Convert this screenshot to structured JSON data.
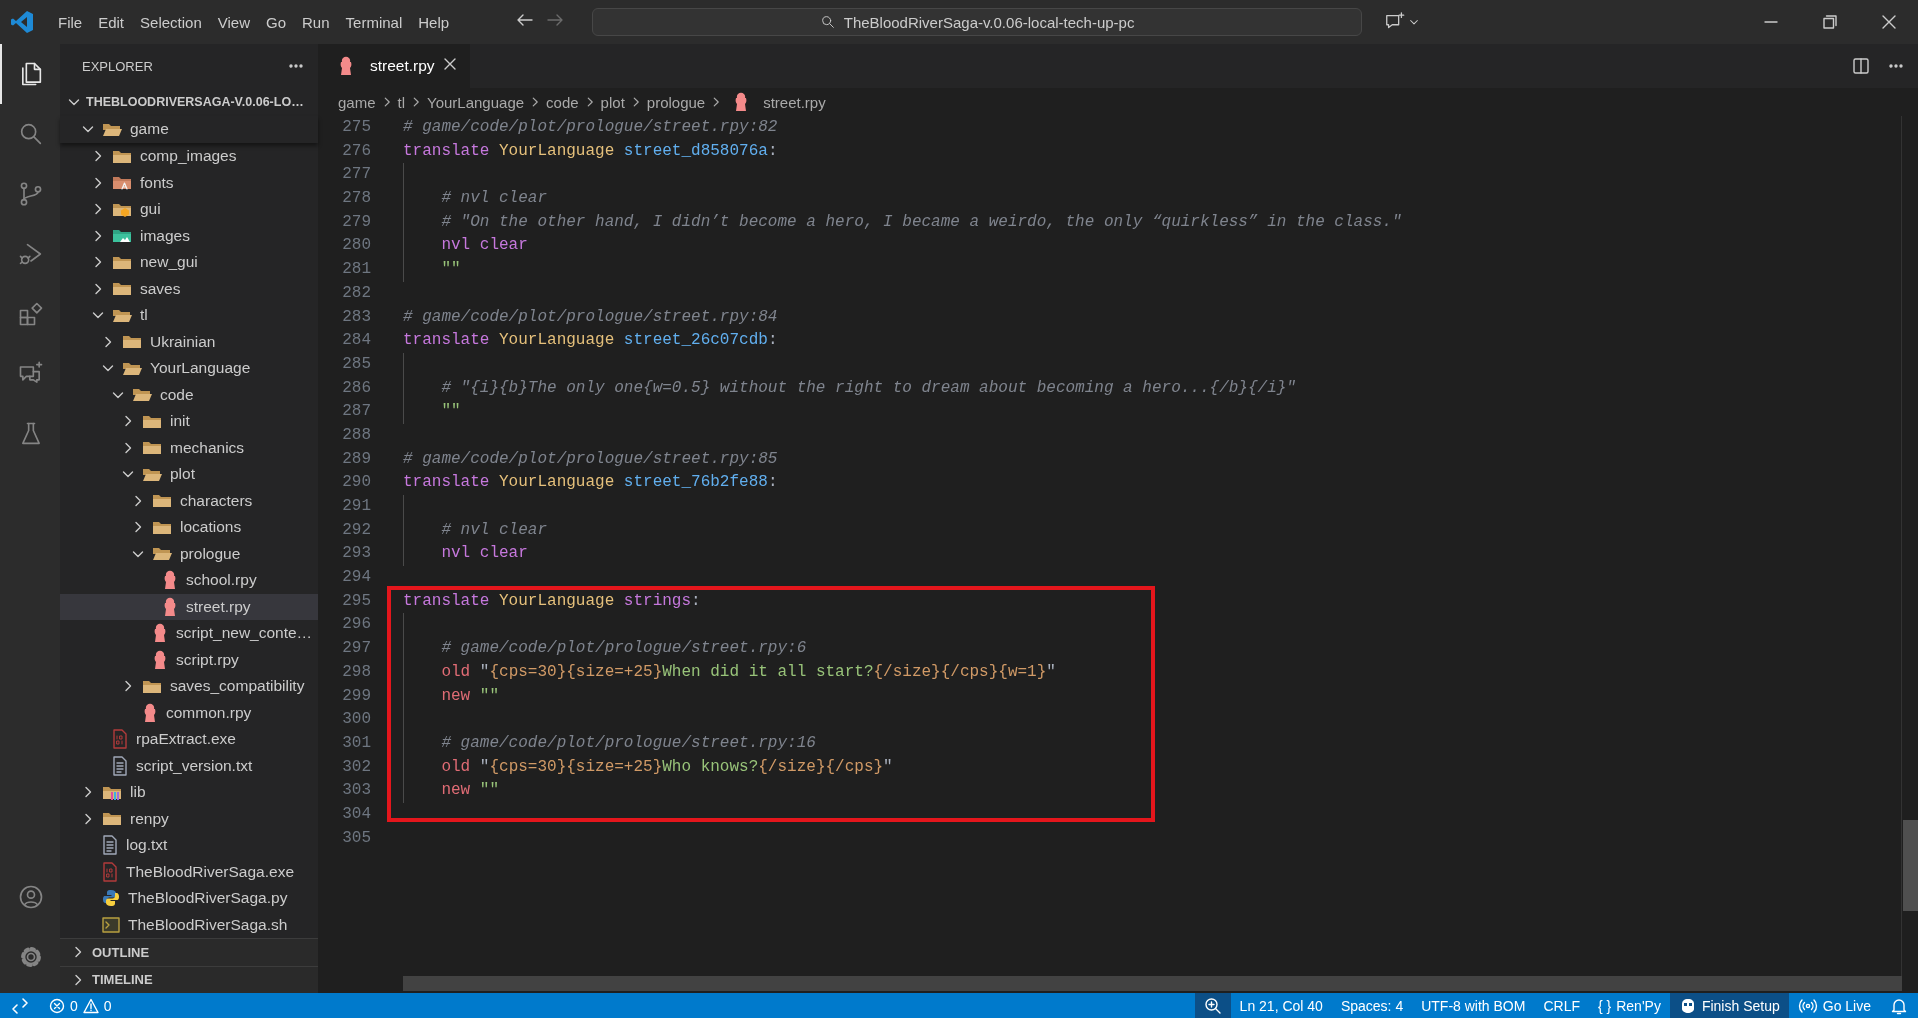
{
  "titlebar": {
    "menu": [
      "File",
      "Edit",
      "Selection",
      "View",
      "Go",
      "Run",
      "Terminal",
      "Help"
    ],
    "navigation": [
      {
        "kind": "back",
        "disabled": false
      },
      {
        "kind": "forward",
        "disabled": true
      }
    ],
    "search": "TheBloodRiverSaga-v.0.06-local-tech-up-pc"
  },
  "activity_bar": {
    "top": [
      {
        "kind": "explorer",
        "selected": true
      },
      {
        "kind": "search",
        "selected": false
      },
      {
        "kind": "source-control",
        "selected": false
      },
      {
        "kind": "run-debug",
        "selected": false
      },
      {
        "kind": "extensions",
        "selected": false
      },
      {
        "kind": "chat",
        "selected": false
      },
      {
        "kind": "testing",
        "selected": false
      }
    ],
    "bottom": [
      {
        "kind": "account"
      },
      {
        "kind": "manage"
      }
    ]
  },
  "sidebar": {
    "title": "EXPLORER",
    "root": {
      "label": "THEBLOODRIVERSAGA-V.0.06-LO…",
      "expanded": true
    },
    "tree": [
      {
        "label": "game",
        "kind": "folder",
        "expanded": true,
        "selected": false,
        "children": [
          {
            "label": "comp_images",
            "kind": "folder",
            "expanded": false,
            "selected": false
          },
          {
            "label": "fonts",
            "kind": "fonts-folder",
            "expanded": false,
            "selected": false
          },
          {
            "label": "gui",
            "kind": "gui-folder",
            "expanded": false,
            "selected": false
          },
          {
            "label": "images",
            "kind": "images-folder",
            "expanded": false,
            "selected": false
          },
          {
            "label": "new_gui",
            "kind": "folder",
            "expanded": false,
            "selected": false
          },
          {
            "label": "saves",
            "kind": "folder",
            "expanded": false,
            "selected": false
          },
          {
            "label": "tl",
            "kind": "folder",
            "expanded": true,
            "selected": false,
            "children": [
              {
                "label": "Ukrainian",
                "kind": "folder",
                "expanded": false,
                "selected": false
              },
              {
                "label": "YourLanguage",
                "kind": "folder",
                "expanded": true,
                "selected": false,
                "children": [
                  {
                    "label": "code",
                    "kind": "folder",
                    "expanded": true,
                    "selected": false,
                    "children": [
                      {
                        "label": "init",
                        "kind": "folder",
                        "expanded": false,
                        "selected": false
                      },
                      {
                        "label": "mechanics",
                        "kind": "folder",
                        "expanded": false,
                        "selected": false
                      },
                      {
                        "label": "plot",
                        "kind": "folder",
                        "expanded": true,
                        "selected": false,
                        "children": [
                          {
                            "label": "characters",
                            "kind": "folder",
                            "expanded": false,
                            "selected": false
                          },
                          {
                            "label": "locations",
                            "kind": "folder",
                            "expanded": false,
                            "selected": false
                          },
                          {
                            "label": "prologue",
                            "kind": "folder",
                            "expanded": true,
                            "selected": false,
                            "children": [
                              {
                                "label": "school.rpy",
                                "kind": "renpy",
                                "selected": false
                              },
                              {
                                "label": "street.rpy",
                                "kind": "renpy",
                                "selected": true
                              }
                            ]
                          },
                          {
                            "label": "script_new_conte…",
                            "kind": "renpy",
                            "selected": false
                          },
                          {
                            "label": "script.rpy",
                            "kind": "renpy",
                            "selected": false
                          }
                        ]
                      },
                      {
                        "label": "saves_compatibility",
                        "kind": "folder",
                        "expanded": false,
                        "selected": false
                      },
                      {
                        "label": "common.rpy",
                        "kind": "renpy",
                        "selected": false
                      }
                    ]
                  }
                ]
              }
            ]
          },
          {
            "label": "rpaExtract.exe",
            "kind": "binary",
            "selected": false
          },
          {
            "label": "script_version.txt",
            "kind": "text",
            "selected": false
          }
        ]
      },
      {
        "label": "lib",
        "kind": "lib-folder",
        "expanded": false,
        "selected": false
      },
      {
        "label": "renpy",
        "kind": "folder",
        "expanded": false,
        "selected": false
      },
      {
        "label": "log.txt",
        "kind": "text",
        "selected": false
      },
      {
        "label": "TheBloodRiverSaga.exe",
        "kind": "binary",
        "selected": false
      },
      {
        "label": "TheBloodRiverSaga.py",
        "kind": "python",
        "selected": false
      },
      {
        "label": "TheBloodRiverSaga.sh",
        "kind": "shell",
        "selected": false
      }
    ],
    "panels": [
      {
        "label": "OUTLINE",
        "expanded": false
      },
      {
        "label": "TIMELINE",
        "expanded": false
      }
    ]
  },
  "tabs": [
    {
      "label": "street.rpy",
      "selected": true
    }
  ],
  "breadcrumbs": [
    {
      "label": "game",
      "kind": "folder"
    },
    {
      "label": "tl",
      "kind": "folder"
    },
    {
      "label": "YourLanguage",
      "kind": "folder"
    },
    {
      "label": "code",
      "kind": "folder"
    },
    {
      "label": "plot",
      "kind": "folder"
    },
    {
      "label": "prologue",
      "kind": "folder"
    },
    {
      "label": "street.rpy",
      "kind": "renpy"
    }
  ],
  "editor": {
    "blocks": [
      {
        "framed": false,
        "lines": [
          {
            "number": "275",
            "indented": false,
            "tokens": [
              {
                "kind": "comment",
                "text": "# game/code/plot/prologue/street.rpy:82"
              }
            ]
          },
          {
            "number": "276",
            "indented": false,
            "tokens": [
              {
                "kind": "keyword",
                "text": "translate "
              },
              {
                "kind": "language",
                "text": "YourLanguage "
              },
              {
                "kind": "label",
                "text": "street_d858076a"
              },
              {
                "kind": "plain",
                "text": ":"
              }
            ]
          },
          {
            "number": "277",
            "indented": true
          },
          {
            "number": "278",
            "indented": true,
            "tokens": [
              {
                "kind": "comment",
                "text": "# nvl clear"
              }
            ]
          },
          {
            "number": "279",
            "indented": true,
            "tokens": [
              {
                "kind": "comment",
                "text": "# \"On the other hand, I didn’t become a hero, I became a weirdo, the only “quirkless” in the class.\""
              }
            ]
          },
          {
            "number": "280",
            "indented": true,
            "tokens": [
              {
                "kind": "keyword",
                "text": "nvl clear"
              }
            ]
          },
          {
            "number": "281",
            "indented": true,
            "tokens": [
              {
                "kind": "string",
                "text": "\"\""
              }
            ]
          },
          {
            "number": "282",
            "indented": false
          },
          {
            "number": "283",
            "indented": false,
            "tokens": [
              {
                "kind": "comment",
                "text": "# game/code/plot/prologue/street.rpy:84"
              }
            ]
          },
          {
            "number": "284",
            "indented": false,
            "tokens": [
              {
                "kind": "keyword",
                "text": "translate "
              },
              {
                "kind": "language",
                "text": "YourLanguage "
              },
              {
                "kind": "label",
                "text": "street_26c07cdb"
              },
              {
                "kind": "plain",
                "text": ":"
              }
            ]
          },
          {
            "number": "285",
            "indented": true
          },
          {
            "number": "286",
            "indented": true,
            "tokens": [
              {
                "kind": "comment",
                "text": "# \"{i}{b}The only one{w=0.5} without the right to dream about becoming a hero...{/b}{/i}\""
              }
            ]
          },
          {
            "number": "287",
            "indented": true,
            "tokens": [
              {
                "kind": "string",
                "text": "\"\""
              }
            ]
          },
          {
            "number": "288",
            "indented": false
          },
          {
            "number": "289",
            "indented": false,
            "tokens": [
              {
                "kind": "comment",
                "text": "# game/code/plot/prologue/street.rpy:85"
              }
            ]
          },
          {
            "number": "290",
            "indented": false,
            "tokens": [
              {
                "kind": "keyword",
                "text": "translate "
              },
              {
                "kind": "language",
                "text": "YourLanguage "
              },
              {
                "kind": "label",
                "text": "street_76b2fe88"
              },
              {
                "kind": "plain",
                "text": ":"
              }
            ]
          },
          {
            "number": "291",
            "indented": true
          },
          {
            "number": "292",
            "indented": true,
            "tokens": [
              {
                "kind": "comment",
                "text": "# nvl clear"
              }
            ]
          },
          {
            "number": "293",
            "indented": true,
            "tokens": [
              {
                "kind": "keyword",
                "text": "nvl clear"
              }
            ]
          },
          {
            "number": "294",
            "indented": false
          }
        ]
      },
      {
        "framed": true,
        "lines": [
          {
            "number": "295",
            "indented": false,
            "tokens": [
              {
                "kind": "keyword",
                "text": "translate "
              },
              {
                "kind": "language",
                "text": "YourLanguage "
              },
              {
                "kind": "keyword",
                "text": "strings"
              },
              {
                "kind": "plain",
                "text": ":"
              }
            ]
          },
          {
            "number": "296",
            "indented": true
          },
          {
            "number": "297",
            "indented": true,
            "tokens": [
              {
                "kind": "comment",
                "text": "# game/code/plot/prologue/street.rpy:6"
              }
            ]
          },
          {
            "number": "298",
            "indented": true,
            "tokens": [
              {
                "kind": "property",
                "text": "old "
              },
              {
                "kind": "plain",
                "text": "\""
              },
              {
                "kind": "tag",
                "text": "{cps=30}{size=+25}"
              },
              {
                "kind": "string",
                "text": "When did it all start?"
              },
              {
                "kind": "tag",
                "text": "{/size}{/cps}{w=1}"
              },
              {
                "kind": "plain",
                "text": "\""
              }
            ]
          },
          {
            "number": "299",
            "indented": true,
            "tokens": [
              {
                "kind": "property",
                "text": "new "
              },
              {
                "kind": "string",
                "text": "\"\""
              }
            ]
          },
          {
            "number": "300",
            "indented": true
          },
          {
            "number": "301",
            "indented": true,
            "tokens": [
              {
                "kind": "comment",
                "text": "# game/code/plot/prologue/street.rpy:16"
              }
            ]
          },
          {
            "number": "302",
            "indented": true,
            "tokens": [
              {
                "kind": "property",
                "text": "old "
              },
              {
                "kind": "plain",
                "text": "\""
              },
              {
                "kind": "tag",
                "text": "{cps=30}{size=+25}"
              },
              {
                "kind": "string",
                "text": "Who knows?"
              },
              {
                "kind": "tag",
                "text": "{/size}{/cps}"
              },
              {
                "kind": "plain",
                "text": "\""
              }
            ]
          },
          {
            "number": "303",
            "indented": true,
            "tokens": [
              {
                "kind": "property",
                "text": "new "
              },
              {
                "kind": "string",
                "text": "\"\""
              }
            ]
          },
          {
            "number": "304",
            "indented": false
          }
        ]
      },
      {
        "framed": false,
        "lines": [
          {
            "number": "305",
            "indented": false
          }
        ]
      }
    ]
  },
  "status_bar": {
    "left": [
      {
        "kind": "remote"
      },
      {
        "kind": "problems",
        "errors": "0",
        "warnings": "0"
      }
    ],
    "right": [
      {
        "kind": "zoom",
        "prominent": true
      },
      {
        "kind": "text",
        "label": "Ln 21, Col 40",
        "prominent": false
      },
      {
        "kind": "text",
        "label": "Spaces: 4",
        "prominent": false
      },
      {
        "kind": "text",
        "label": "UTF-8 with BOM",
        "prominent": false
      },
      {
        "kind": "text",
        "label": "CRLF",
        "prominent": false
      },
      {
        "kind": "language",
        "symbol": "{ }",
        "label": "Ren'Py",
        "prominent": false
      },
      {
        "kind": "copilot",
        "label": "Finish Setup",
        "prominent": true
      },
      {
        "kind": "live",
        "label": "Go Live",
        "prominent": false
      },
      {
        "kind": "bell",
        "prominent": false
      }
    ]
  }
}
